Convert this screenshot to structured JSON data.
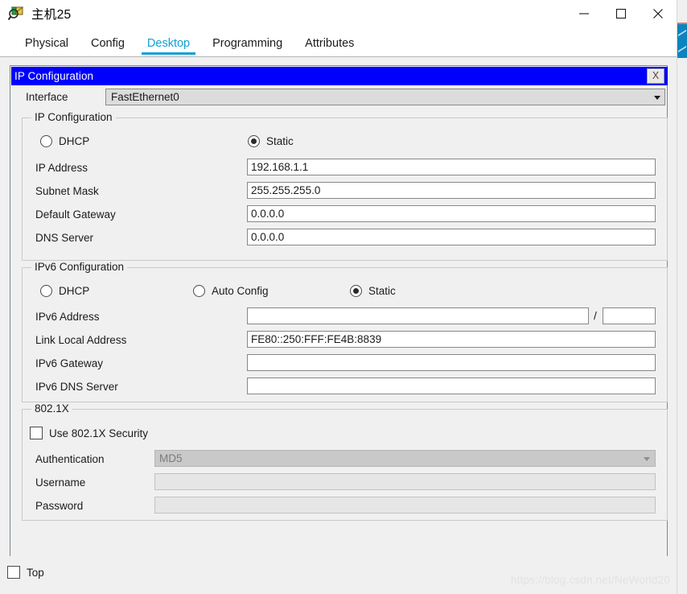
{
  "window": {
    "title": "主机25",
    "icon": "packet-tracer-host-icon",
    "controls": {
      "minimize": "minimize-icon",
      "maximize": "maximize-icon",
      "close": "close-icon"
    }
  },
  "tabs": [
    {
      "label": "Physical",
      "active": false
    },
    {
      "label": "Config",
      "active": false
    },
    {
      "label": "Desktop",
      "active": true
    },
    {
      "label": "Programming",
      "active": false
    },
    {
      "label": "Attributes",
      "active": false
    }
  ],
  "dialog": {
    "title": "IP Configuration",
    "close_label": "X",
    "interface": {
      "label": "Interface",
      "value": "FastEthernet0"
    },
    "ipv4": {
      "legend": "IP Configuration",
      "mode_dhcp": "DHCP",
      "mode_static": "Static",
      "selected_mode": "Static",
      "fields": [
        {
          "label": "IP Address",
          "value": "192.168.1.1"
        },
        {
          "label": "Subnet Mask",
          "value": "255.255.255.0"
        },
        {
          "label": "Default Gateway",
          "value": "0.0.0.0"
        },
        {
          "label": "DNS Server",
          "value": "0.0.0.0"
        }
      ]
    },
    "ipv6": {
      "legend": "IPv6 Configuration",
      "mode_dhcp": "DHCP",
      "mode_auto": "Auto Config",
      "mode_static": "Static",
      "selected_mode": "Static",
      "prefix_separator": "/",
      "fields": [
        {
          "label": "IPv6 Address",
          "value": ""
        },
        {
          "label": "Link Local Address",
          "value": "FE80::250:FFF:FE4B:8839"
        },
        {
          "label": "IPv6 Gateway",
          "value": ""
        },
        {
          "label": "IPv6 DNS Server",
          "value": ""
        }
      ],
      "prefix_value": ""
    },
    "dot1x": {
      "legend": "802.1X",
      "use_security_label": "Use 802.1X Security",
      "use_security_checked": false,
      "auth_label": "Authentication",
      "auth_value": "MD5",
      "username_label": "Username",
      "username_value": "",
      "password_label": "Password",
      "password_value": ""
    }
  },
  "bottom": {
    "top_label": "Top",
    "top_checked": false,
    "watermark": "https://blog.csdn.net/NeWorld20"
  },
  "colors": {
    "dialog_title_bg": "#0000ff",
    "active_tab": "#12a0d4",
    "panel_bg": "#f0f0f0",
    "scrollbar_thumb": "#0c84c0"
  }
}
